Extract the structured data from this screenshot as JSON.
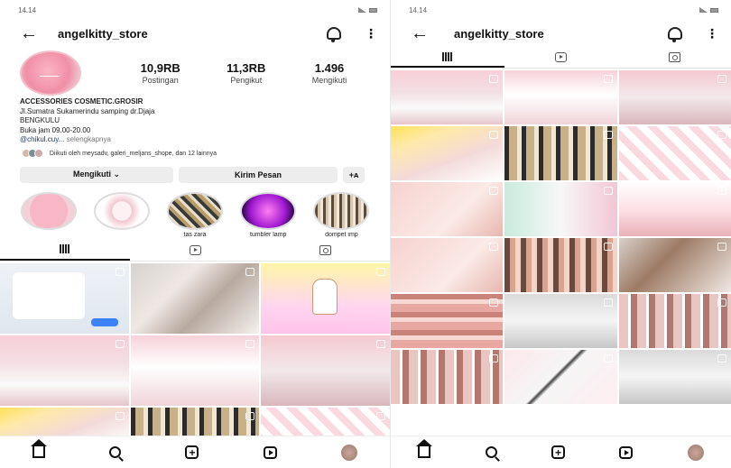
{
  "status": {
    "time": "14.14"
  },
  "header": {
    "username": "angelkitty_store"
  },
  "profile": {
    "stats": [
      {
        "value": "10,9RB",
        "label": "Postingan"
      },
      {
        "value": "11,3RB",
        "label": "Pengikut"
      },
      {
        "value": "1.496",
        "label": "Mengikuti"
      }
    ],
    "bio": {
      "name": "ACCESSORIES COSMETIC.GROSIR",
      "line1": "Jl.Sumatra Sukamerindu samping dr.Djaja",
      "line2": "BENGKULU",
      "line3": "Buka jam 09.00-20.00",
      "link": "@chikul.cuy...",
      "more": "selengkapnya"
    },
    "followed_by": "Diikuti oleh meysadv, galeri_meljans_shope, dan 12 lainnya"
  },
  "buttons": {
    "following": "Mengikuti ⌄",
    "message": "Kirim Pesan",
    "add_person": "+ᴀ"
  },
  "highlights": [
    {
      "label": ""
    },
    {
      "label": ""
    },
    {
      "label": "tas zara"
    },
    {
      "label": "tumbler lamp"
    },
    {
      "label": "dompet imp"
    }
  ],
  "tabs": [
    {
      "icon": "grid-icon"
    },
    {
      "icon": "reels-icon"
    },
    {
      "icon": "tagged-icon"
    }
  ],
  "nav": [
    {
      "icon": "home-icon"
    },
    {
      "icon": "search-icon"
    },
    {
      "icon": "add-post-icon"
    },
    {
      "icon": "reels-icon"
    },
    {
      "icon": "profile-avatar"
    }
  ],
  "colors": {
    "accent_pink": "#f08fa6",
    "link_blue": "#1d3c6b"
  }
}
